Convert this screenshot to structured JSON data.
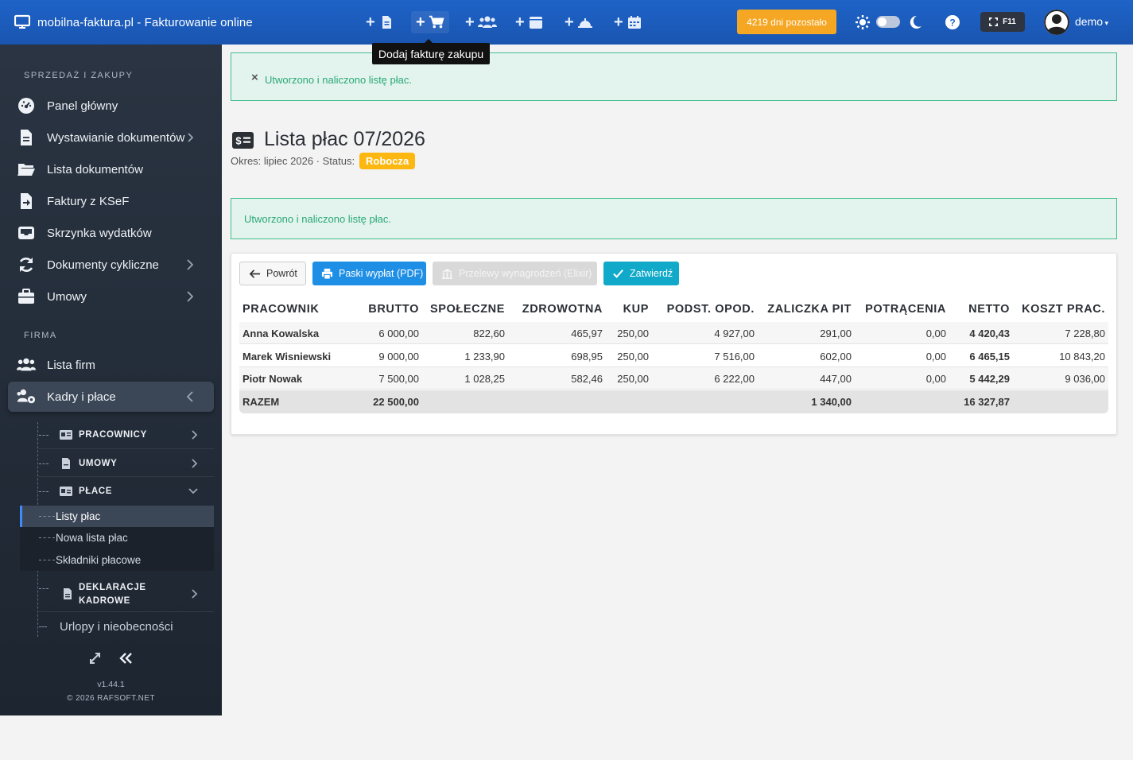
{
  "topbar": {
    "brand": "mobilna-faktura.pl - Fakturowanie online",
    "quick_plus": "+",
    "days_left": "4219 dni pozostało",
    "f11_label": "F11",
    "user": "demo",
    "tooltip": "Dodaj fakturę zakupu",
    "quick_icons": [
      "document-icon",
      "cart-icon",
      "users-icon",
      "box-icon",
      "bell-icon",
      "calendar-icon"
    ]
  },
  "sidebar": {
    "section_sales": "SPRZEDAŻ I ZAKUPY",
    "items_sales": [
      {
        "label": "Panel główny",
        "icon": "dashboard-icon"
      },
      {
        "label": "Wystawianie dokumentów",
        "icon": "file-icon"
      },
      {
        "label": "Lista dokumentów",
        "icon": "folder-icon"
      },
      {
        "label": "Faktury z KSeF",
        "icon": "file-import-icon"
      },
      {
        "label": "Skrzynka wydatków",
        "icon": "inbox-icon"
      },
      {
        "label": "Dokumenty cykliczne",
        "icon": "sync-icon"
      },
      {
        "label": "Umowy",
        "icon": "briefcase-icon"
      }
    ],
    "section_company": "FIRMA",
    "items_company": [
      {
        "label": "Lista firm",
        "icon": "users-icon"
      },
      {
        "label": "Kadry i płace",
        "icon": "users-cog-icon"
      }
    ],
    "sub": [
      {
        "label": "PRACOWNICY"
      },
      {
        "label": "UMOWY"
      },
      {
        "label": "PŁACE"
      },
      {
        "label_line1": "DEKLARACJE",
        "label_line2": "KADROWE"
      }
    ],
    "leaves": [
      "Listy płac",
      "Nowa lista płac",
      "Składniki płacowe"
    ],
    "urlopy": "Urlopy i nieobecności",
    "version": "v1.44.1",
    "copyright": "© 2026 RAFSOFT.NET"
  },
  "alerts": {
    "top": "Utworzono i naliczono listę płac.",
    "close": "×",
    "inline": "Utworzono i naliczono listę płac."
  },
  "page": {
    "title": "Lista płac 07/2026",
    "period": "Okres: lipiec 2026 · Status:",
    "status": "Robocza"
  },
  "buttons": {
    "back": "Powrót",
    "pdf": "Paski wypłat (PDF)",
    "elixir": "Przelewy wynagrodzeń (Elixir)",
    "approve": "Zatwierdź"
  },
  "table": {
    "headers": [
      "PRACOWNIK",
      "BRUTTO",
      "SPOŁECZNE",
      "ZDROWOTNA",
      "KUP",
      "PODST. OPOD.",
      "ZALICZKA PIT",
      "POTRĄCENIA",
      "NETTO",
      "KOSZT PRAC."
    ],
    "rows": [
      [
        "Anna Kowalska",
        "6 000,00",
        "822,60",
        "465,97",
        "250,00",
        "4 927,00",
        "291,00",
        "0,00",
        "4 420,43",
        "7 228,80"
      ],
      [
        "Marek Wisniewski",
        "9 000,00",
        "1 233,90",
        "698,95",
        "250,00",
        "7 516,00",
        "602,00",
        "0,00",
        "6 465,15",
        "10 843,20"
      ],
      [
        "Piotr Nowak",
        "7 500,00",
        "1 028,25",
        "582,46",
        "250,00",
        "6 222,00",
        "447,00",
        "0,00",
        "5 442,29",
        "9 036,00"
      ]
    ],
    "total": {
      "label": "RAZEM",
      "brutto": "22 500,00",
      "pit": "1 340,00",
      "netto": "16 327,87"
    }
  },
  "colors": {
    "topbar": "#1e63c8",
    "sidebar": "#2a3442",
    "success": "#2aa876",
    "status": "#fcb711",
    "accent": "#f5a623"
  }
}
